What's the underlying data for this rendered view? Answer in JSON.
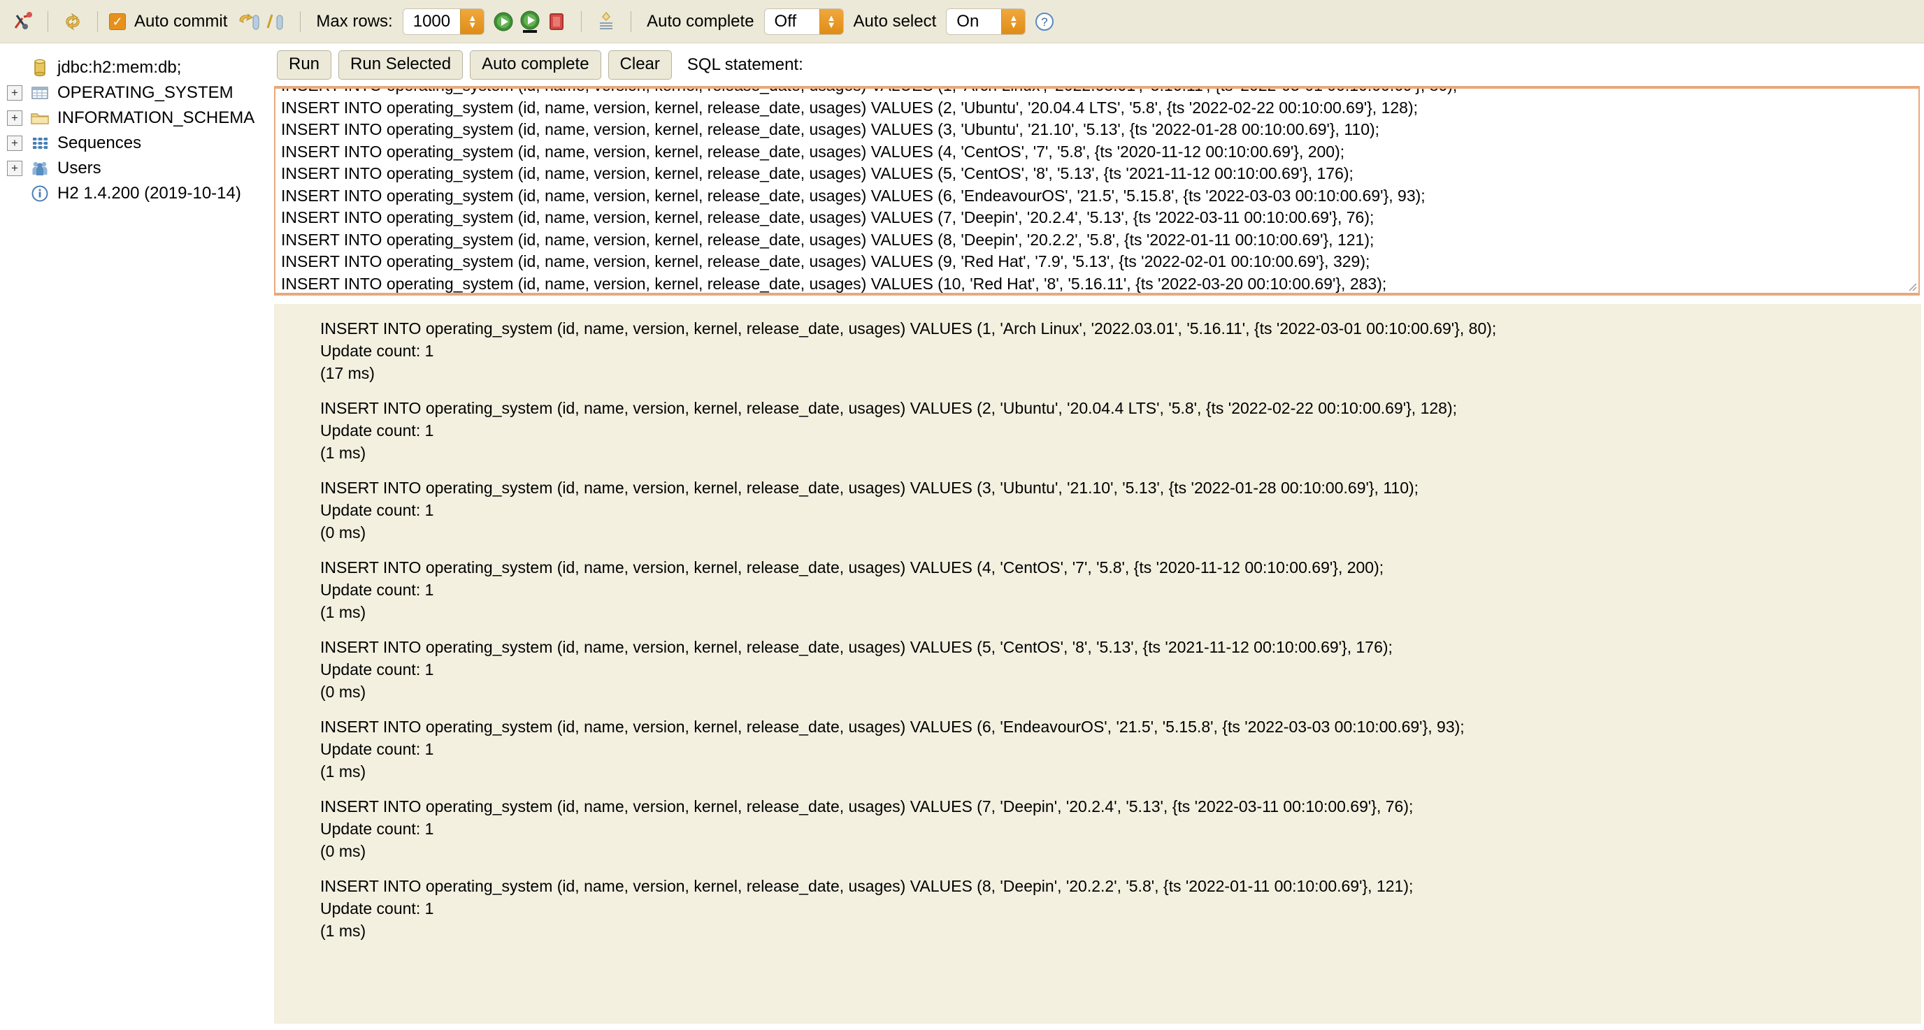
{
  "toolbar": {
    "icons": [
      {
        "name": "disconnect-icon",
        "glyph": "disconnect"
      },
      {
        "name": "refresh-icon",
        "glyph": "refresh"
      }
    ],
    "auto_commit_label": "Auto commit",
    "auto_commit_checked": true,
    "commit_icon": "commit-icon",
    "rollback_icon": "rollback-icon",
    "max_rows_label": "Max rows:",
    "max_rows_value": "1000",
    "run_icon": "run-icon",
    "run_selected_icon": "run-selected-icon",
    "stop_icon": "stop-icon",
    "history_icon": "history-icon",
    "auto_complete_label": "Auto complete",
    "auto_complete_value": "Off",
    "auto_select_label": "Auto select",
    "auto_select_value": "On",
    "help_icon": "help-icon",
    "help_glyph": "?",
    "accent_orange": "#e8901c",
    "bg": "#ece9d8"
  },
  "sidebar": {
    "items": [
      {
        "label": "jdbc:h2:mem:db;",
        "icon": "database-icon",
        "toggle": null
      },
      {
        "label": "OPERATING_SYSTEM",
        "icon": "table-icon",
        "toggle": "+"
      },
      {
        "label": "INFORMATION_SCHEMA",
        "icon": "folder-icon",
        "toggle": "+"
      },
      {
        "label": "Sequences",
        "icon": "sequences-icon",
        "toggle": "+"
      },
      {
        "label": "Users",
        "icon": "users-icon",
        "toggle": "+"
      },
      {
        "label": "H2 1.4.200 (2019-10-14)",
        "icon": "info-icon",
        "toggle": null
      }
    ]
  },
  "main": {
    "buttons": [
      {
        "name": "run-button",
        "label": "Run"
      },
      {
        "name": "run-selected-button",
        "label": "Run Selected"
      },
      {
        "name": "auto-complete-button",
        "label": "Auto complete"
      },
      {
        "name": "clear-button",
        "label": "Clear"
      }
    ],
    "sql_statement_label": "SQL statement:",
    "sql_lines": [
      "INSERT INTO operating_system (id, name, version, kernel, release_date, usages) VALUES (1, 'Arch Linux', '2022.03.01', '5.16.11', {ts '2022-03-01 00:10:00.69'}, 80);",
      "INSERT INTO operating_system (id, name, version, kernel, release_date, usages) VALUES (2, 'Ubuntu', '20.04.4 LTS', '5.8', {ts '2022-02-22 00:10:00.69'}, 128);",
      "INSERT INTO operating_system (id, name, version, kernel, release_date, usages) VALUES (3, 'Ubuntu', '21.10', '5.13', {ts '2022-01-28 00:10:00.69'}, 110);",
      "INSERT INTO operating_system (id, name, version, kernel, release_date, usages) VALUES (4, 'CentOS', '7', '5.8', {ts '2020-11-12 00:10:00.69'}, 200);",
      "INSERT INTO operating_system (id, name, version, kernel, release_date, usages) VALUES (5, 'CentOS', '8', '5.13', {ts '2021-11-12 00:10:00.69'}, 176);",
      "INSERT INTO operating_system (id, name, version, kernel, release_date, usages) VALUES (6, 'EndeavourOS', '21.5', '5.15.8', {ts '2022-03-03 00:10:00.69'}, 93);",
      "INSERT INTO operating_system (id, name, version, kernel, release_date, usages) VALUES (7, 'Deepin', '20.2.4', '5.13', {ts '2022-03-11 00:10:00.69'}, 76);",
      "INSERT INTO operating_system (id, name, version, kernel, release_date, usages) VALUES (8, 'Deepin', '20.2.2', '5.8', {ts '2022-01-11 00:10:00.69'}, 121);",
      "INSERT INTO operating_system (id, name, version, kernel, release_date, usages) VALUES (9, 'Red Hat', '7.9', '5.13', {ts '2022-02-01 00:10:00.69'}, 329);",
      "INSERT INTO operating_system (id, name, version, kernel, release_date, usages) VALUES (10, 'Red Hat', '8', '5.16.11', {ts '2022-03-20 00:10:00.69'}, 283);"
    ],
    "results": [
      {
        "sql": "INSERT INTO operating_system (id, name, version, kernel, release_date, usages) VALUES (1, 'Arch Linux', '2022.03.01', '5.16.11', {ts '2022-03-01 00:10:00.69'}, 80);",
        "update_count": "Update count: 1",
        "time": "(17 ms)"
      },
      {
        "sql": "INSERT INTO operating_system (id, name, version, kernel, release_date, usages) VALUES (2, 'Ubuntu', '20.04.4 LTS', '5.8', {ts '2022-02-22 00:10:00.69'}, 128);",
        "update_count": "Update count: 1",
        "time": "(1 ms)"
      },
      {
        "sql": "INSERT INTO operating_system (id, name, version, kernel, release_date, usages) VALUES (3, 'Ubuntu', '21.10', '5.13', {ts '2022-01-28 00:10:00.69'}, 110);",
        "update_count": "Update count: 1",
        "time": "(0 ms)"
      },
      {
        "sql": "INSERT INTO operating_system (id, name, version, kernel, release_date, usages) VALUES (4, 'CentOS', '7', '5.8', {ts '2020-11-12 00:10:00.69'}, 200);",
        "update_count": "Update count: 1",
        "time": "(1 ms)"
      },
      {
        "sql": "INSERT INTO operating_system (id, name, version, kernel, release_date, usages) VALUES (5, 'CentOS', '8', '5.13', {ts '2021-11-12 00:10:00.69'}, 176);",
        "update_count": "Update count: 1",
        "time": "(0 ms)"
      },
      {
        "sql": "INSERT INTO operating_system (id, name, version, kernel, release_date, usages) VALUES (6, 'EndeavourOS', '21.5', '5.15.8', {ts '2022-03-03 00:10:00.69'}, 93);",
        "update_count": "Update count: 1",
        "time": "(1 ms)"
      },
      {
        "sql": "INSERT INTO operating_system (id, name, version, kernel, release_date, usages) VALUES (7, 'Deepin', '20.2.4', '5.13', {ts '2022-03-11 00:10:00.69'}, 76);",
        "update_count": "Update count: 1",
        "time": "(0 ms)"
      },
      {
        "sql": "INSERT INTO operating_system (id, name, version, kernel, release_date, usages) VALUES (8, 'Deepin', '20.2.2', '5.8', {ts '2022-01-11 00:10:00.69'}, 121);",
        "update_count": "Update count: 1",
        "time": "(1 ms)"
      }
    ]
  }
}
